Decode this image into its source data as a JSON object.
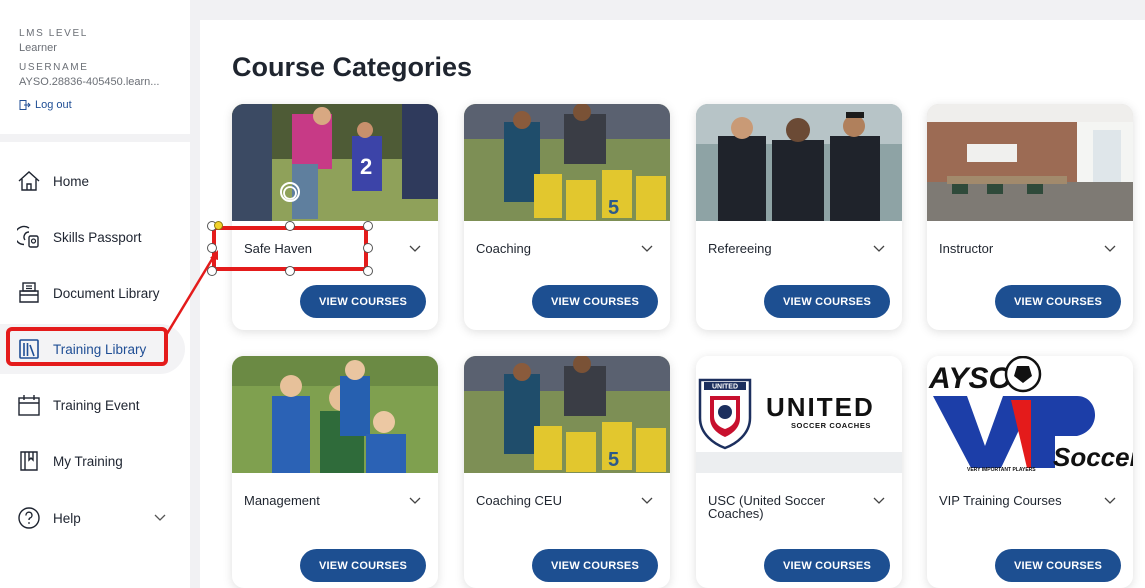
{
  "sidebar": {
    "meta": {
      "lms_level_label": "LMS LEVEL",
      "lms_level_value": "Learner",
      "username_label": "USERNAME",
      "username_value": "AYSO.28836-405450.learn...",
      "logout": "Log out"
    },
    "items": [
      {
        "label": "Home",
        "icon": "home-icon"
      },
      {
        "label": "Skills Passport",
        "icon": "passport-icon"
      },
      {
        "label": "Document Library",
        "icon": "document-icon"
      },
      {
        "label": "Training Library",
        "icon": "library-icon",
        "active": true
      },
      {
        "label": "Training Event",
        "icon": "calendar-icon"
      },
      {
        "label": "My Training",
        "icon": "book-icon"
      },
      {
        "label": "Help",
        "icon": "help-icon",
        "expandable": true
      }
    ]
  },
  "main": {
    "title": "Course Categories",
    "button_label": "VIEW COURSES",
    "categories": [
      {
        "title": "Safe Haven"
      },
      {
        "title": "Coaching"
      },
      {
        "title": "Refereeing"
      },
      {
        "title": "Instructor"
      },
      {
        "title": "Management"
      },
      {
        "title": "Coaching CEU"
      },
      {
        "title": "USC (United Soccer Coaches)"
      },
      {
        "title": "VIP Training Courses"
      }
    ]
  },
  "logos": {
    "usc_word": "UNITED",
    "usc_sub": "SOCCER COACHES",
    "usc_badge": "UNITED",
    "vip_ayso": "AYSO",
    "vip_soccer": "Soccer",
    "vip_tag": "VERY IMPORTANT PLAYERS"
  },
  "colors": {
    "accent": "#1d4f91",
    "annotation": "#e41b1b"
  }
}
